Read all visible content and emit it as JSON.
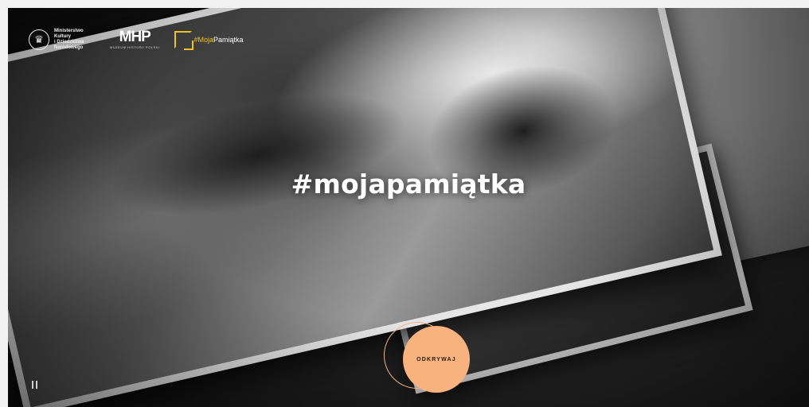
{
  "header": {
    "ministry_logo": {
      "icon": "eagle-emblem-icon",
      "text": "Ministerstwo\nKultury\ni Dziedzictwa\nNarodowego"
    },
    "muzeum_logo": {
      "mark": "MHP",
      "subtitle": "MUZEUM HISTORII POLSKI"
    },
    "campaign_logo": {
      "icon": "corner-brackets-icon",
      "hash_part": "#Moja",
      "rest_part": "Pamiątka"
    }
  },
  "hero": {
    "headline": "#mojapamiątka"
  },
  "cta": {
    "label": "ODKRYWAJ",
    "color": "#f7b27d"
  },
  "controls": {
    "pause_icon": "pause-icon"
  },
  "colors": {
    "accent": "#f7b27d",
    "campaign_yellow": "#f2c21b",
    "text": "#ffffff"
  }
}
